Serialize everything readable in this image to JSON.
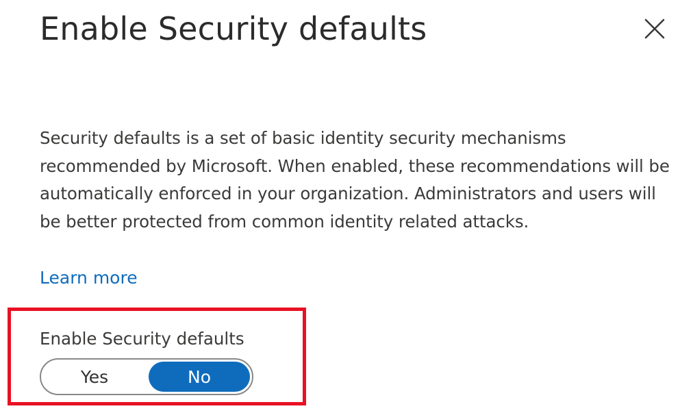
{
  "panel": {
    "title": "Enable Security defaults",
    "close_icon": "close-icon",
    "description": "Security defaults is a set of basic identity security mechanisms recommended by Microsoft. When enabled, these recommendations will be automatically enforced in your organization. Administrators and users will be better protected from common identity related attacks.",
    "learn_more": "Learn more"
  },
  "toggle": {
    "label": "Enable Security defaults",
    "options": [
      "Yes",
      "No"
    ],
    "selected": "No"
  },
  "colors": {
    "accent": "#0f6cbd",
    "highlight": "#e81123"
  }
}
